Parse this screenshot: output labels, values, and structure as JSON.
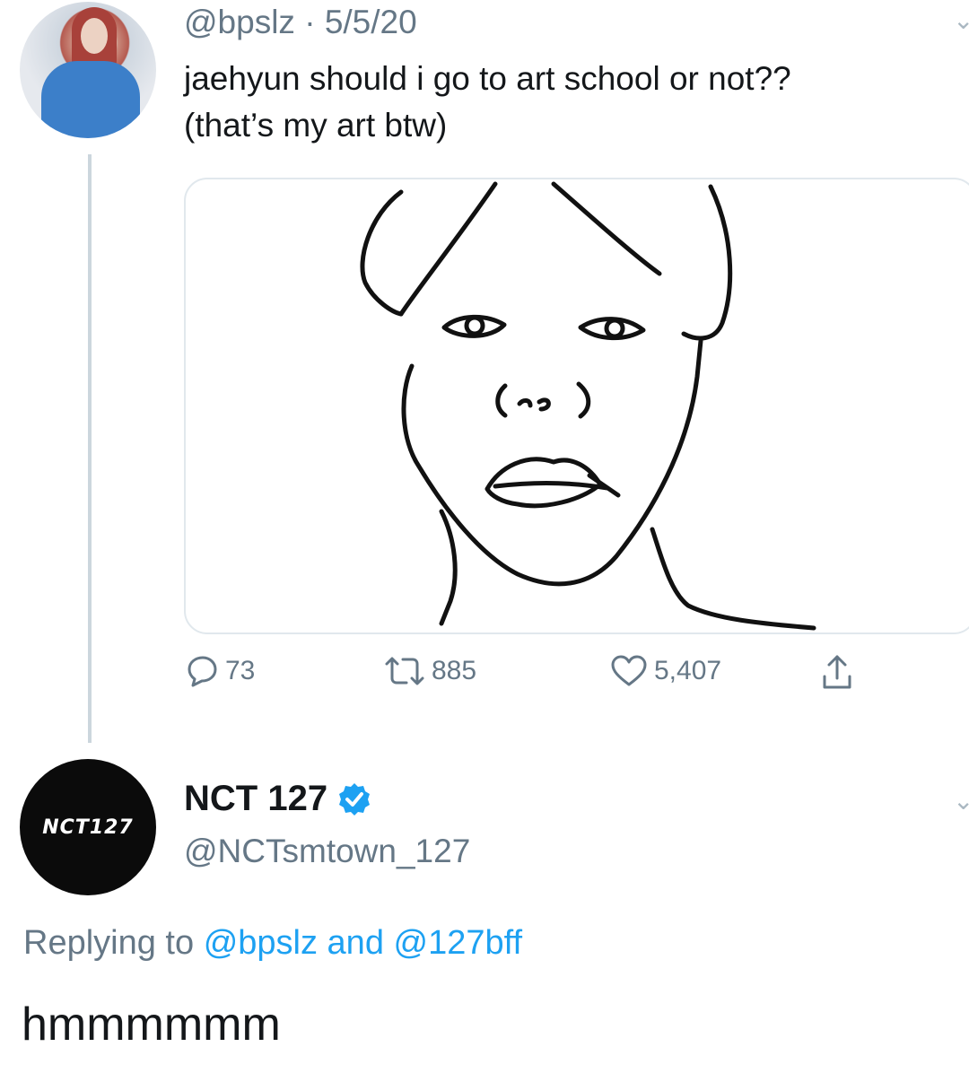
{
  "tweet": {
    "handle_date": "@bpslz · 5/5/20",
    "text_line1": "jaehyun should i go to art school or not??",
    "text_line2": "(that’s my art btw)",
    "stats": {
      "replies": "73",
      "retweets": "885",
      "likes": "5,407"
    }
  },
  "reply": {
    "avatar_text": "NCT127",
    "name": "NCT 127",
    "handle": "@NCTsmtown_127",
    "replying_prefix": "Replying to",
    "replying_user1": "@bpslz",
    "replying_and": "and",
    "replying_user2": "@127bff",
    "text": "hmmmmmm"
  },
  "colors": {
    "accent": "#1da1f2",
    "muted": "#657786",
    "text": "#14171a"
  }
}
